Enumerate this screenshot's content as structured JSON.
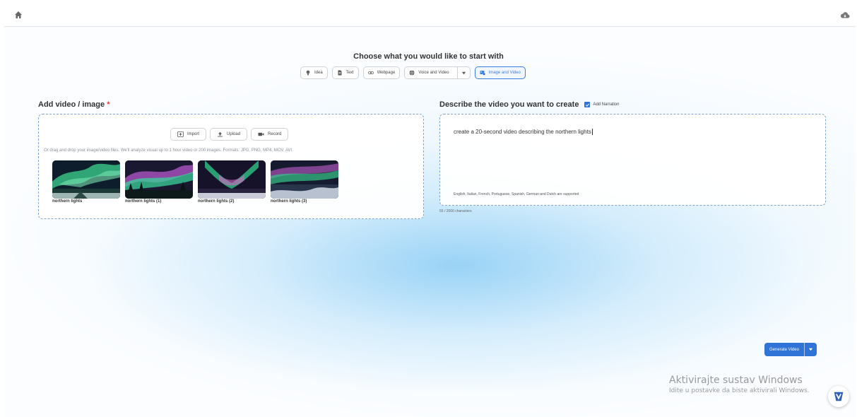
{
  "header": {
    "home_icon": "home-icon",
    "cloud_icon": "cloud-icon"
  },
  "start": {
    "title": "Choose what you would like to start with",
    "options": [
      {
        "label": "Idea",
        "icon": "lightbulb-icon"
      },
      {
        "label": "Text",
        "icon": "document-icon"
      },
      {
        "label": "Webpage",
        "icon": "link-icon"
      },
      {
        "label": "Voice and Video",
        "icon": "globe-icon"
      },
      {
        "label": "Image and Video",
        "icon": "image-video-icon",
        "selected": true
      }
    ]
  },
  "media": {
    "title": "Add video / image",
    "required_mark": "*",
    "buttons": {
      "import": "Import",
      "upload": "Upload",
      "record": "Record"
    },
    "drop_hint": "Or drag and drop your image/video files. We'll analyze visual up to 1 hour video or 200 images. Formats: JPG, PNG, MP4, MOV, AVI.",
    "files": [
      {
        "label": "northern lights"
      },
      {
        "label": "northern lights (1)"
      },
      {
        "label": "northern lights (2)"
      },
      {
        "label": "northern lights (3)"
      }
    ]
  },
  "describe": {
    "title": "Describe the video you want to create",
    "narration_label": "Add Narration",
    "narration_checked": true,
    "prompt": "create a 20-second video describing the northern lights",
    "languages_note": "English, Italian, French, Portuguese, Spanish, German and Dutch are supported",
    "char_count": "55 / 2000 characters"
  },
  "actions": {
    "generate_label": "Generate Video"
  },
  "windows": {
    "line1": "Aktivirajte sustav Windows",
    "line2": "Idite u postavke da biste aktivirali Windows."
  },
  "colors": {
    "accent": "#2f74d6",
    "required": "#e23b3b",
    "border": "#7fa4d4"
  }
}
